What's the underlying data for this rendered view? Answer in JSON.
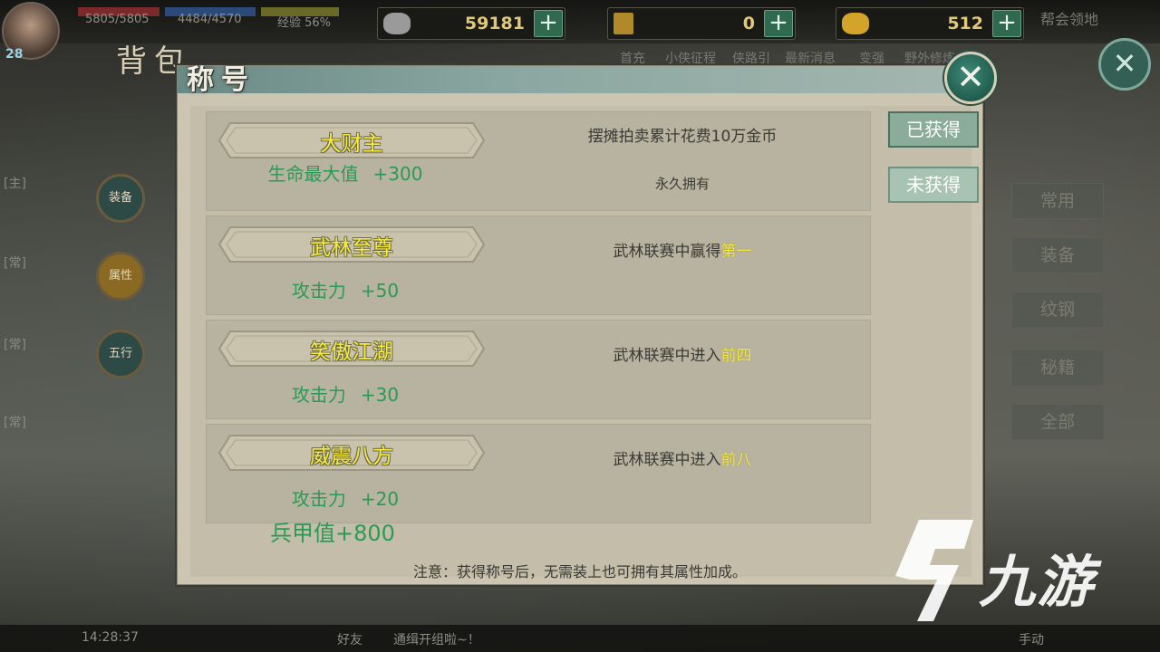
{
  "hud": {
    "level": "28",
    "hp": "5805/5805",
    "mp": "4484/4570",
    "exp": "经验 56%",
    "currencies": [
      {
        "icon": "silver-ingot-icon",
        "value": "59181"
      },
      {
        "icon": "token-icon",
        "value": "0"
      },
      {
        "icon": "gold-ingot-icon",
        "value": "512"
      }
    ],
    "top_menu": [
      "首充",
      "小侠征程",
      "侠路引",
      "最新消息",
      "变强",
      "野外修炼"
    ],
    "guild": "帮会领地",
    "back_title": "背包"
  },
  "side_discs": [
    "装备",
    "属性",
    "五行"
  ],
  "right_tabs": [
    "常用",
    "装备",
    "纹钢",
    "秘籍",
    "全部"
  ],
  "left_tags": [
    "[主]",
    "[常]",
    "[常]",
    "[常]"
  ],
  "bottom": {
    "time": "14:28:37",
    "friends": "好友",
    "chat": "通缉开组啦~！",
    "mode": "手动"
  },
  "dialog": {
    "title": "称号",
    "close_symbol": "✕",
    "filters": [
      {
        "label": "已获得",
        "state": "active"
      },
      {
        "label": "未获得",
        "state": "inactive"
      }
    ],
    "titles": [
      {
        "name": "大财主",
        "bonus_stat": "生命最大值",
        "bonus_value": "+300",
        "condition_prefix": "摆摊拍卖累计花费10万金币",
        "condition_highlight": "",
        "duration": "永久拥有"
      },
      {
        "name": "武林至尊",
        "bonus_stat": "攻击力",
        "bonus_value": "+50",
        "condition_prefix": "武林联赛中赢得",
        "condition_highlight": "第一",
        "duration": ""
      },
      {
        "name": "笑傲江湖",
        "bonus_stat": "攻击力",
        "bonus_value": "+30",
        "condition_prefix": "武林联赛中进入",
        "condition_highlight": "前四",
        "duration": ""
      },
      {
        "name": "威震八方",
        "bonus_stat": "攻击力",
        "bonus_value": "+20",
        "condition_prefix": "武林联赛中进入",
        "condition_highlight": "前八",
        "duration": ""
      }
    ],
    "total": "兵甲值+800",
    "note": "注意：获得称号后，无需装上也可拥有其属性加成。"
  },
  "watermark": "九游",
  "colors": {
    "title_yellow": "#f7ec3a",
    "bonus_green": "#2c9a54",
    "panel": "#cbc5b2",
    "button_teal": "#7aa08b"
  }
}
